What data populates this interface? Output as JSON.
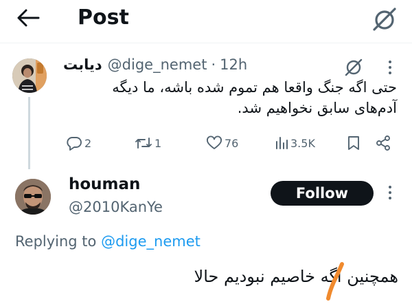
{
  "header": {
    "title": "Post",
    "back_icon": "arrow-left-icon",
    "grok_icon": "grok-icon"
  },
  "parent_post": {
    "display_name": "دیابت",
    "handle": "@dige_nemet",
    "separator": "·",
    "time": "12h",
    "text": "حتی اگه جنگ واقعا هم تموم شده باشه، ما دیگه آدم‌های سابق نخواهیم شد.",
    "stats": {
      "replies": "2",
      "reposts": "1",
      "likes": "76",
      "views": "3.5K"
    }
  },
  "reply_post": {
    "display_name": "houman",
    "handle": "@2010KanYe",
    "follow_label": "Follow",
    "replying_prefix": "Replying to",
    "replying_to": "@dige_nemet",
    "text": "همچنین اگه خاصیم نبودیم حالا"
  },
  "colors": {
    "text": "#0f1419",
    "muted": "#536471",
    "link": "#1d9bf0",
    "thread_line": "#cfd9de",
    "annotation": "#f08a2e"
  }
}
